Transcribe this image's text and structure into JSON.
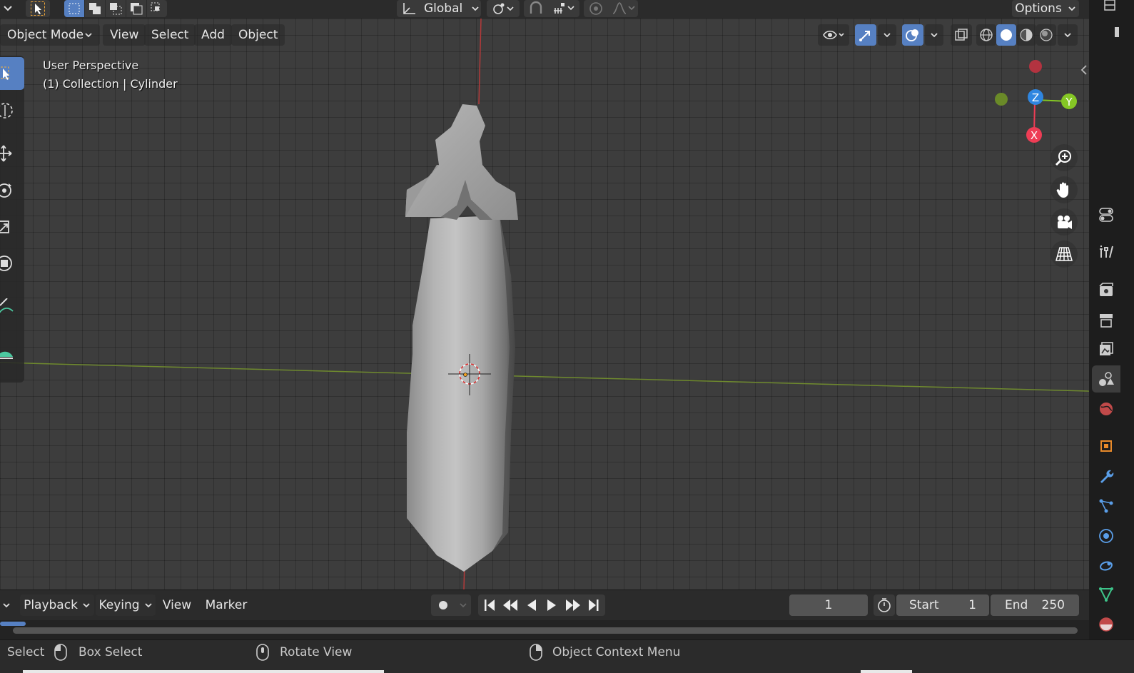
{
  "top_header": {
    "orientation_label": "Global",
    "options_label": "Options"
  },
  "viewport_header": {
    "mode_label": "Object Mode",
    "menus": [
      "View",
      "Select",
      "Add",
      "Object"
    ]
  },
  "viewport_overlay": {
    "perspective": "User Perspective",
    "collection_info": "(1) Collection | Cylinder"
  },
  "gizmo": {
    "z_label": "Z",
    "y_label": "Y",
    "x_label": "X",
    "colors": {
      "x": "#ee3d55",
      "y": "#85c725",
      "z": "#2f86e0"
    }
  },
  "timeline": {
    "menus": [
      "Playback",
      "Keying",
      "View",
      "Marker"
    ],
    "current_frame": "1",
    "start_label": "Start",
    "start_value": "1",
    "end_label": "End",
    "end_value": "250"
  },
  "statusbar": {
    "select_label": "Select",
    "box_select_label": "Box Select",
    "rotate_view_label": "Rotate View",
    "context_menu_label": "Object Context Menu"
  },
  "colors": {
    "accent": "#5680c2",
    "background": "#3d3d3d",
    "panel": "#2b2b2b"
  }
}
